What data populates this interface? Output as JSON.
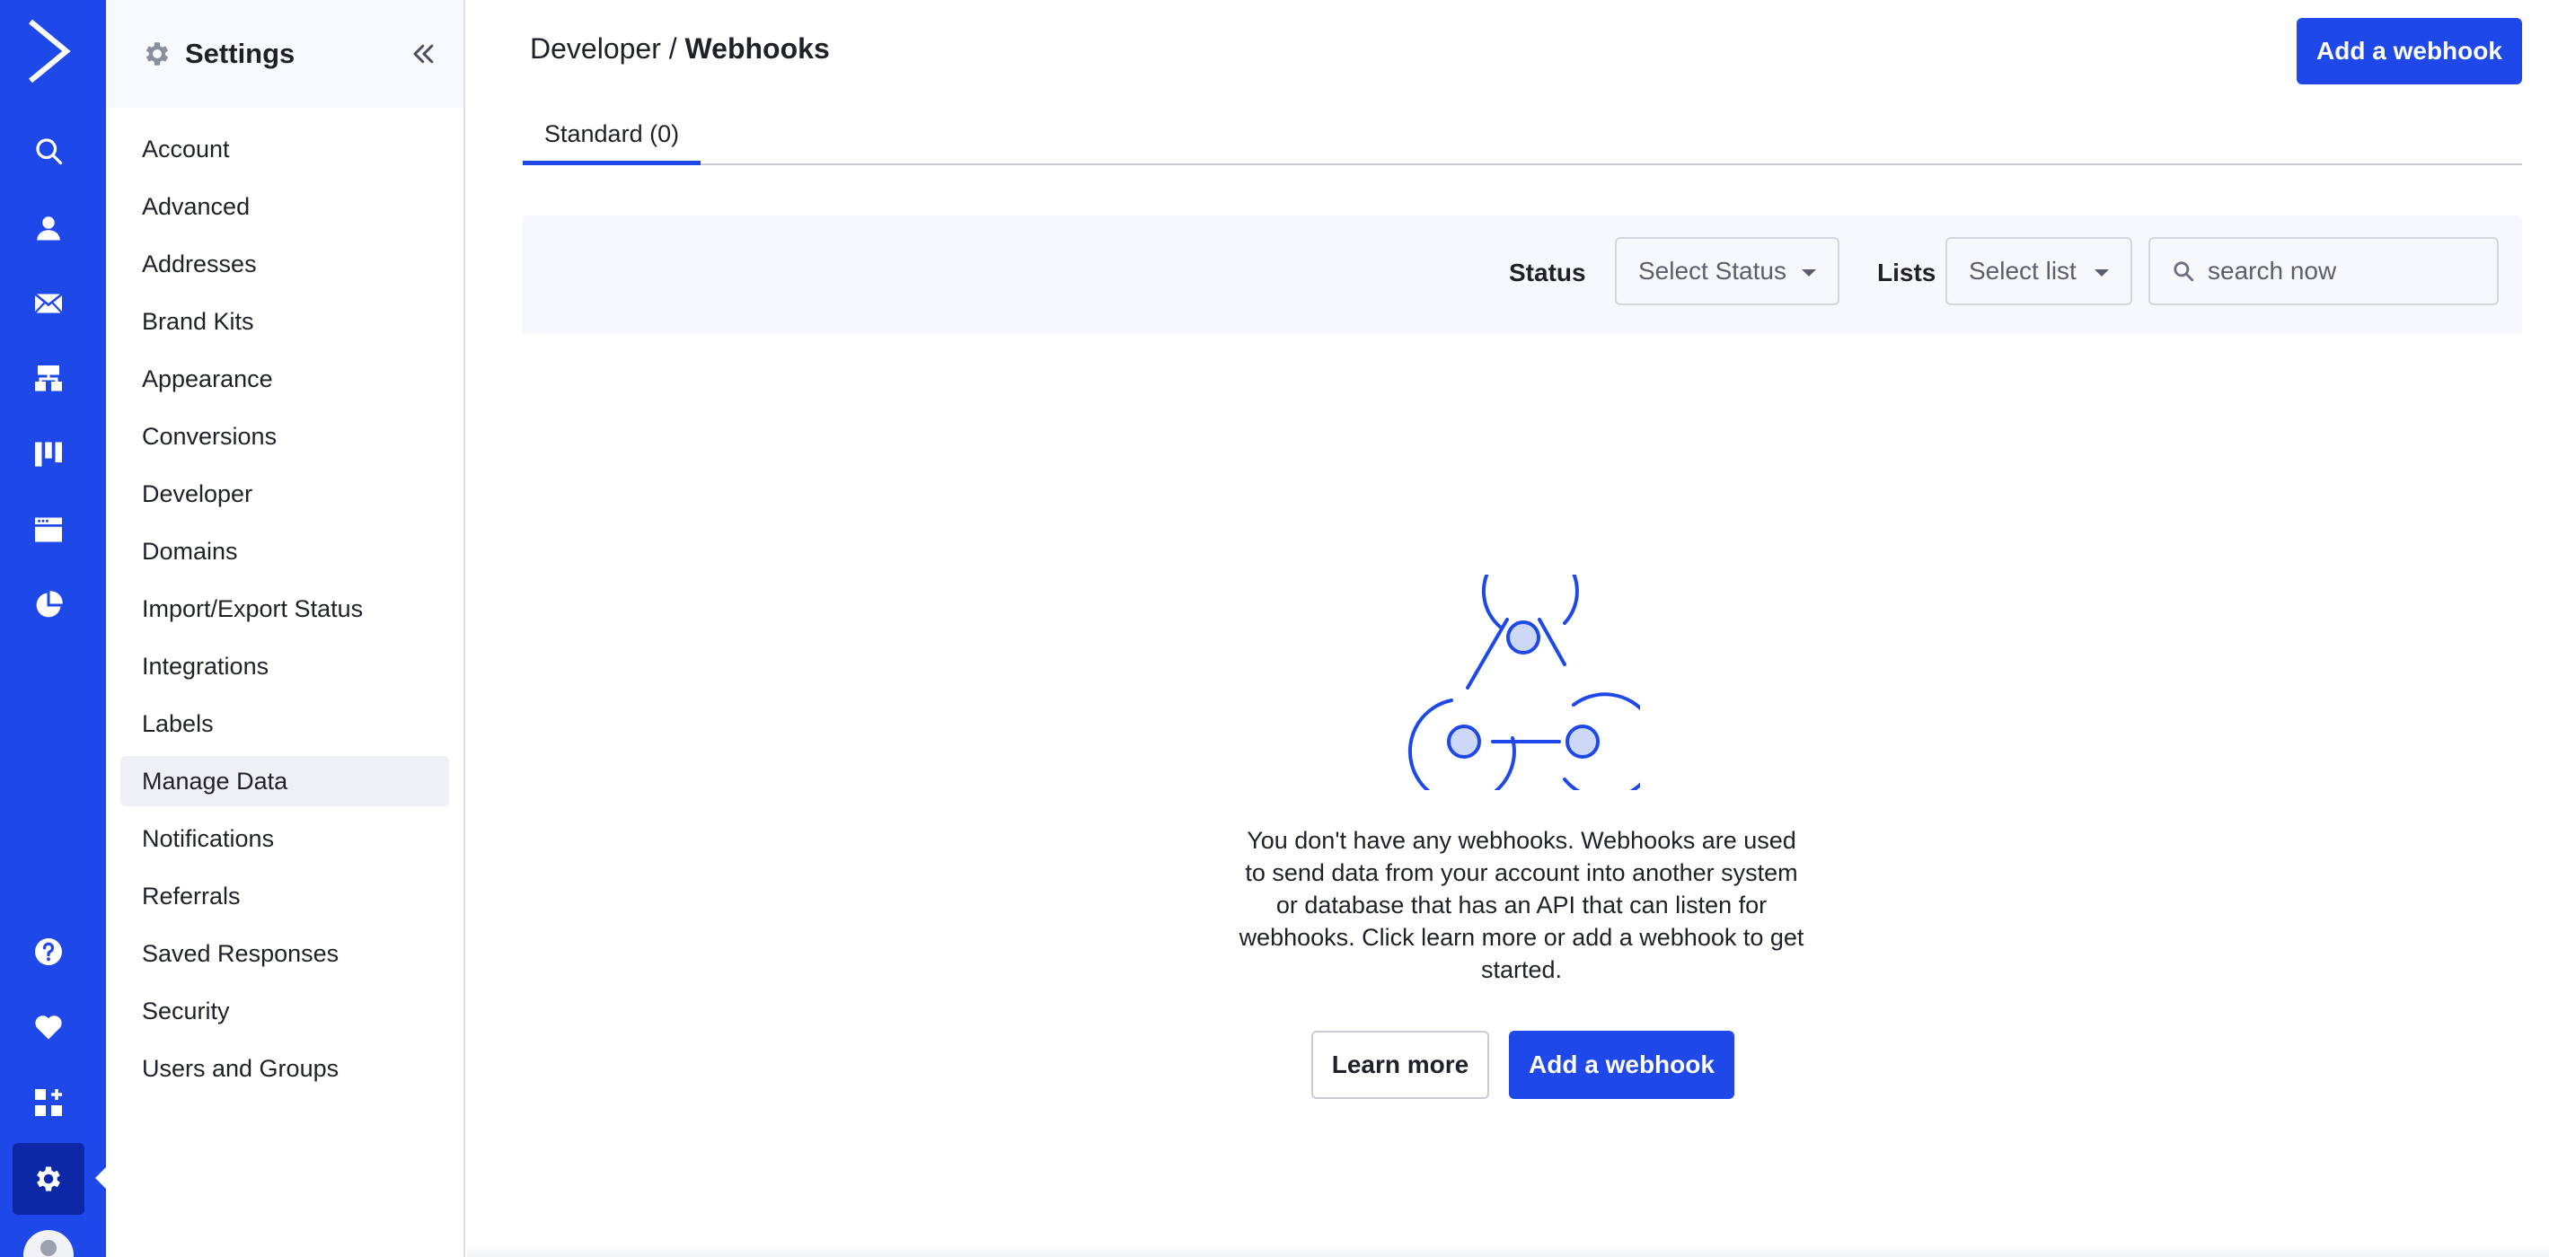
{
  "rail": {
    "logo_icon": "activecampaign-chevron-logo",
    "icons": [
      {
        "name": "search-icon"
      },
      {
        "name": "contacts-icon"
      },
      {
        "name": "campaigns-icon"
      },
      {
        "name": "automations-icon"
      },
      {
        "name": "deals-icon"
      },
      {
        "name": "site-icon"
      },
      {
        "name": "reports-icon"
      },
      {
        "name": "help-icon"
      },
      {
        "name": "favorites-icon"
      },
      {
        "name": "apps-icon"
      },
      {
        "name": "settings-icon"
      }
    ],
    "active": "settings-icon",
    "color": "#1e48e8"
  },
  "sidebar": {
    "title": "Settings",
    "items": [
      {
        "label": "Account"
      },
      {
        "label": "Advanced"
      },
      {
        "label": "Addresses"
      },
      {
        "label": "Brand Kits"
      },
      {
        "label": "Appearance"
      },
      {
        "label": "Conversions"
      },
      {
        "label": "Developer"
      },
      {
        "label": "Domains"
      },
      {
        "label": "Import/Export Status"
      },
      {
        "label": "Integrations"
      },
      {
        "label": "Labels"
      },
      {
        "label": "Manage Data"
      },
      {
        "label": "Notifications"
      },
      {
        "label": "Referrals"
      },
      {
        "label": "Saved Responses"
      },
      {
        "label": "Security"
      },
      {
        "label": "Users and Groups"
      }
    ],
    "highlighted": "Manage Data"
  },
  "header": {
    "breadcrumb_parent": "Developer",
    "breadcrumb_separator": " / ",
    "breadcrumb_current": "Webhooks",
    "add_button": "Add a webhook"
  },
  "tabs": [
    {
      "label": "Standard (0)",
      "active": true
    }
  ],
  "filters": {
    "status_label": "Status",
    "status_select": "Select Status",
    "lists_label": "Lists",
    "lists_select": "Select list",
    "search_placeholder": "search now"
  },
  "empty_state": {
    "illustration_icon": "webhook-icon",
    "message": "You don't have any webhooks. Webhooks are used to send data from your account into another system or database that has an API that can listen for webhooks. Click learn more or add a webhook to get started.",
    "learn_more": "Learn more",
    "add_button": "Add a webhook"
  },
  "colors": {
    "primary": "#1e48e8",
    "rail_active": "#0d28a6",
    "filter_bg": "#f6f8fc"
  }
}
